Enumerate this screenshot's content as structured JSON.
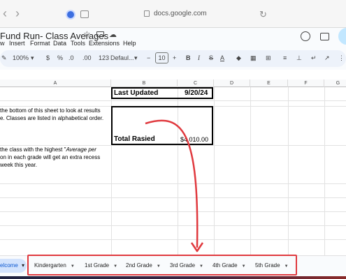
{
  "browser": {
    "url": "docs.google.com"
  },
  "doc": {
    "title": "Fund Run- Class Averages"
  },
  "menu": [
    "w",
    "Insert",
    "Format",
    "Data",
    "Tools",
    "Extensions",
    "Help"
  ],
  "toolbar": {
    "zoom": "100%",
    "currency": "$",
    "percent": "%",
    "dec_decrease": ".0",
    "dec_increase": ".00",
    "number_format": "123",
    "font": "Defaul...",
    "font_size": "10",
    "bold": "B",
    "italic": "I",
    "strike": "S",
    "text_color": "A"
  },
  "columns": [
    "A",
    "B",
    "C",
    "D",
    "E",
    "F",
    "G"
  ],
  "cells": {
    "last_updated_label": "Last Updated",
    "last_updated_value": "9/20/24",
    "total_label": "Total Rasied",
    "total_value": "$4,010.00",
    "instr1_line1": "the bottom of this sheet to look at results",
    "instr1_line2": "e. Classes are listed in alphabetical order.",
    "instr2_line1": "the class with the highest \"",
    "instr2_italic": "Average per",
    "instr2_line2": "on in each grade will get an extra recess",
    "instr2_line3": "week this year."
  },
  "sheets": {
    "current": "elcome",
    "tabs": [
      "Kindergarten",
      "1st Grade",
      "2nd Grade",
      "3rd Grade",
      "4th Grade",
      "5th Grade"
    ]
  },
  "colors": {
    "annotation_red": "#e0393e",
    "active_tab": "#d3e3fd"
  }
}
